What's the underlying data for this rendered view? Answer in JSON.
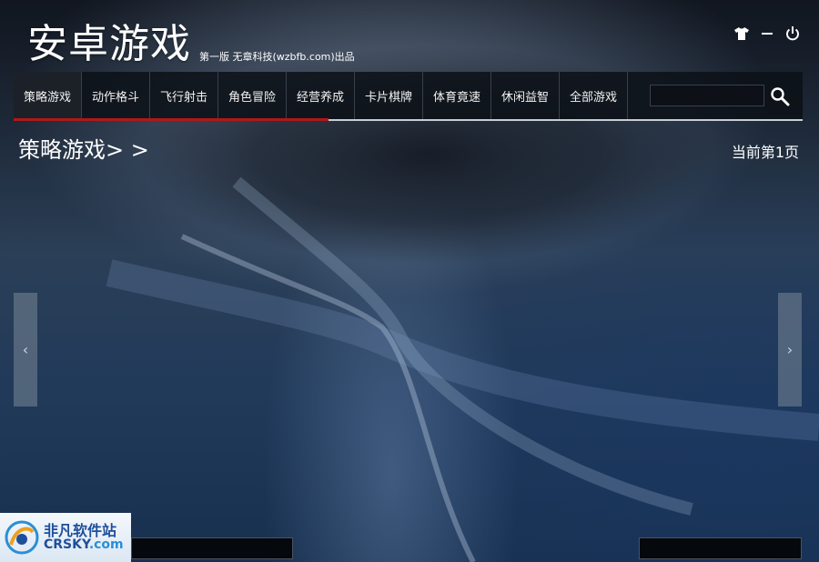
{
  "header": {
    "title": "安卓游戏",
    "subtitle": "第一版 无章科技(wzbfb.com)出品"
  },
  "window_controls": [
    {
      "name": "skin",
      "icon": "tshirt-icon"
    },
    {
      "name": "minimize",
      "icon": "minus-icon"
    },
    {
      "name": "power",
      "icon": "power-icon"
    }
  ],
  "nav": {
    "items": [
      "策略游戏",
      "动作格斗",
      "飞行射击",
      "角色冒险",
      "经营养成",
      "卡片棋牌",
      "体育竟速",
      "休闲益智",
      "全部游戏"
    ],
    "active_index": 0
  },
  "search": {
    "value": "",
    "icon": "search-icon"
  },
  "section": {
    "title": "策略游戏> >",
    "page_indicator": "当前第1页"
  },
  "pager": {
    "prev": "‹",
    "next": "›"
  },
  "watermark": {
    "cn": "非凡软件站",
    "en_main": "CRSKY",
    "en_suffix": ".com"
  },
  "colors": {
    "accent": "#b01818",
    "nav_bg": "#0c1016"
  }
}
